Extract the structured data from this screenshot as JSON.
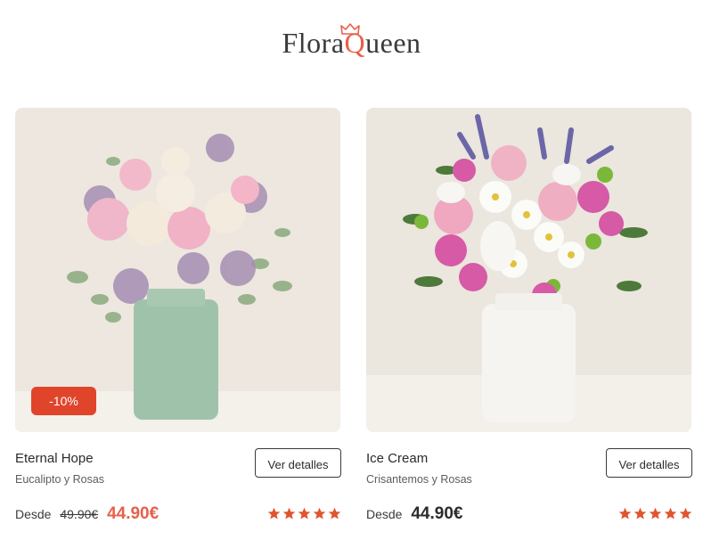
{
  "brand": {
    "name_part1": "Flora",
    "name_part2": "Q",
    "name_part3": "ueen",
    "accent": "#e7604a"
  },
  "products": [
    {
      "name": "Eternal Hope",
      "subtitle": "Eucalipto y Rosas",
      "badge": "-10%",
      "from_label": "Desde",
      "old_price": "49.90€",
      "price": "44.90€",
      "button": "Ver detalles",
      "rating": 5,
      "vase_color": "#9fc2aa"
    },
    {
      "name": "Ice Cream",
      "subtitle": "Crisantemos y Rosas",
      "from_label": "Desde",
      "price": "44.90€",
      "button": "Ver detalles",
      "rating": 5,
      "vase_color": "#f4f2f0"
    }
  ],
  "colors": {
    "star": "#e0542f",
    "badge_bg": "#e0452c"
  }
}
